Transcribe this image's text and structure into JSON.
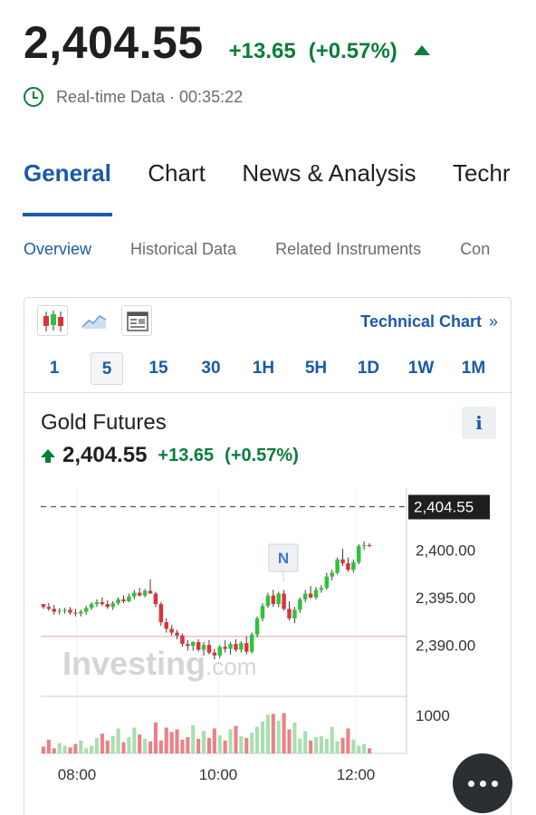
{
  "quote": {
    "price": "2,404.55",
    "change": "+13.65",
    "change_pct": "(+0.57%)",
    "realtime_label": "Real-time Data · 00:35:22"
  },
  "main_tabs": [
    "General",
    "Chart",
    "News & Analysis",
    "Techr"
  ],
  "sub_tabs": [
    "Overview",
    "Historical Data",
    "Related Instruments",
    "Con"
  ],
  "chart_widget": {
    "tech_link": "Technical Chart",
    "tech_chevron": "»",
    "timeframes": [
      "1",
      "5",
      "15",
      "30",
      "1H",
      "5H",
      "1D",
      "1W",
      "1M"
    ],
    "active_timeframe": "5",
    "instrument_name": "Gold Futures",
    "info_label": "i",
    "price": "2,404.55",
    "change": "+13.65",
    "change_pct": "(+0.57%)",
    "news_marker": "N",
    "watermark_main": "Investing",
    "watermark_suffix": ".com"
  },
  "colors": {
    "accent": "#1a5aa6",
    "up": "#0a7d3b",
    "candle_up": "#2fc33a",
    "candle_down": "#e0303c"
  },
  "chart_data": {
    "type": "candlestick",
    "y_ticks": [
      "2,400.00",
      "2,395.00",
      "2,390.00"
    ],
    "y_tick_values": [
      2400,
      2395,
      2390
    ],
    "x_ticks": [
      "08:00",
      "10:00",
      "12:00"
    ],
    "current_price_label": "2,404.55",
    "current_price": 2404.55,
    "previous_close": 2390.9,
    "volume_tick": "1000",
    "ylim": [
      2386.5,
      2406.5
    ],
    "candles": [
      [
        2394.3,
        2394.3,
        2393.8,
        2394.0
      ],
      [
        2394.0,
        2394.4,
        2393.6,
        2393.8
      ],
      [
        2393.8,
        2394.2,
        2393.2,
        2393.5
      ],
      [
        2393.5,
        2393.9,
        2393.2,
        2393.6
      ],
      [
        2393.6,
        2393.9,
        2393.3,
        2393.7
      ],
      [
        2393.7,
        2394.0,
        2393.2,
        2393.4
      ],
      [
        2393.4,
        2393.8,
        2393.0,
        2393.3
      ],
      [
        2393.3,
        2393.7,
        2393.0,
        2393.5
      ],
      [
        2393.5,
        2394.1,
        2393.2,
        2393.9
      ],
      [
        2393.9,
        2394.5,
        2393.7,
        2394.3
      ],
      [
        2394.3,
        2394.8,
        2394.0,
        2394.5
      ],
      [
        2394.5,
        2395.0,
        2394.1,
        2394.3
      ],
      [
        2394.3,
        2394.7,
        2393.8,
        2394.0
      ],
      [
        2394.0,
        2394.6,
        2393.7,
        2394.4
      ],
      [
        2394.4,
        2395.0,
        2394.2,
        2394.8
      ],
      [
        2394.8,
        2395.2,
        2394.4,
        2394.6
      ],
      [
        2394.6,
        2395.4,
        2394.5,
        2395.1
      ],
      [
        2395.1,
        2395.8,
        2394.8,
        2395.5
      ],
      [
        2395.5,
        2396.0,
        2395.1,
        2395.2
      ],
      [
        2395.2,
        2395.9,
        2395.0,
        2395.7
      ],
      [
        2395.7,
        2396.9,
        2395.4,
        2395.4
      ],
      [
        2395.4,
        2395.6,
        2394.0,
        2394.3
      ],
      [
        2394.3,
        2394.5,
        2392.0,
        2392.4
      ],
      [
        2392.4,
        2392.8,
        2391.3,
        2391.7
      ],
      [
        2391.7,
        2392.1,
        2391.0,
        2391.3
      ],
      [
        2391.3,
        2391.6,
        2390.6,
        2391.0
      ],
      [
        2391.0,
        2391.2,
        2389.8,
        2390.1
      ],
      [
        2390.1,
        2390.5,
        2389.4,
        2389.9
      ],
      [
        2389.9,
        2390.4,
        2389.4,
        2390.3
      ],
      [
        2390.3,
        2390.6,
        2389.3,
        2389.5
      ],
      [
        2389.5,
        2390.3,
        2388.9,
        2390.0
      ],
      [
        2390.0,
        2390.5,
        2389.0,
        2389.2
      ],
      [
        2389.2,
        2389.6,
        2388.5,
        2388.9
      ],
      [
        2388.9,
        2390.0,
        2388.6,
        2389.8
      ],
      [
        2389.8,
        2390.5,
        2389.2,
        2389.6
      ],
      [
        2389.6,
        2390.3,
        2389.0,
        2390.1
      ],
      [
        2390.1,
        2390.6,
        2389.3,
        2389.5
      ],
      [
        2389.5,
        2390.4,
        2389.2,
        2390.2
      ],
      [
        2390.2,
        2390.9,
        2389.0,
        2389.3
      ],
      [
        2389.3,
        2391.3,
        2389.1,
        2391.1
      ],
      [
        2391.1,
        2393.0,
        2390.8,
        2392.8
      ],
      [
        2392.8,
        2394.4,
        2392.5,
        2394.1
      ],
      [
        2394.1,
        2395.5,
        2393.9,
        2395.2
      ],
      [
        2395.2,
        2395.8,
        2394.0,
        2394.3
      ],
      [
        2394.3,
        2395.6,
        2394.0,
        2395.4
      ],
      [
        2395.4,
        2395.8,
        2393.6,
        2393.8
      ],
      [
        2393.8,
        2394.6,
        2392.6,
        2392.8
      ],
      [
        2392.8,
        2394.0,
        2392.3,
        2393.7
      ],
      [
        2393.7,
        2395.0,
        2393.4,
        2394.8
      ],
      [
        2394.8,
        2395.8,
        2394.5,
        2395.4
      ],
      [
        2395.4,
        2396.2,
        2394.9,
        2395.0
      ],
      [
        2395.0,
        2396.1,
        2394.8,
        2395.8
      ],
      [
        2395.8,
        2396.3,
        2395.5,
        2396.0
      ],
      [
        2396.0,
        2397.6,
        2395.8,
        2397.2
      ],
      [
        2397.2,
        2397.9,
        2396.8,
        2397.6
      ],
      [
        2397.6,
        2399.2,
        2397.4,
        2399.0
      ],
      [
        2399.0,
        2400.1,
        2398.3,
        2398.6
      ],
      [
        2398.6,
        2399.2,
        2397.7,
        2397.9
      ],
      [
        2397.9,
        2399.0,
        2397.6,
        2398.7
      ],
      [
        2398.7,
        2400.6,
        2398.5,
        2400.4
      ],
      [
        2400.4,
        2400.9,
        2400.0,
        2400.5
      ],
      [
        2400.5,
        2400.7,
        2400.3,
        2400.4
      ]
    ],
    "volumes": [
      80,
      160,
      60,
      120,
      90,
      70,
      110,
      150,
      60,
      90,
      180,
      230,
      150,
      200,
      290,
      130,
      190,
      300,
      220,
      170,
      140,
      360,
      150,
      300,
      250,
      280,
      160,
      190,
      330,
      170,
      260,
      180,
      290,
      210,
      150,
      280,
      320,
      200,
      180,
      240,
      310,
      370,
      450,
      460,
      380,
      470,
      280,
      360,
      170,
      260,
      150,
      190,
      200,
      170,
      310,
      140,
      180,
      290,
      160,
      90,
      110,
      60
    ]
  }
}
